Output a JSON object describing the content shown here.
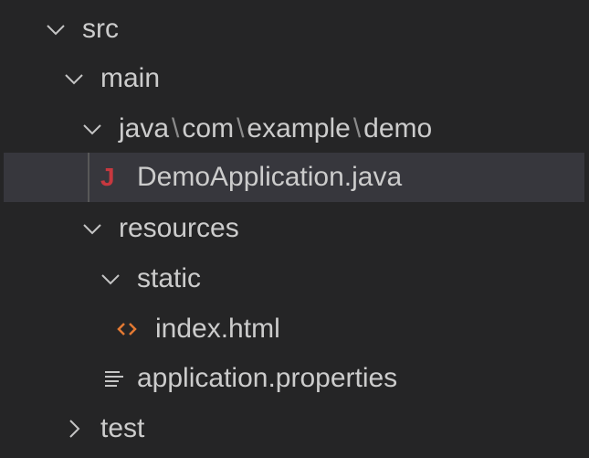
{
  "tree": {
    "src": "src",
    "main": "main",
    "java_path": [
      "java",
      "com",
      "example",
      "demo"
    ],
    "path_separator": "\\",
    "demo_app": "DemoApplication.java",
    "resources": "resources",
    "static": "static",
    "index": "index.html",
    "properties": "application.properties",
    "test": "test"
  },
  "icons": {
    "java_letter": "J"
  },
  "colors": {
    "background": "#252526",
    "selected": "#37373d",
    "java_icon": "#c7383f",
    "html_icon": "#e37933"
  }
}
